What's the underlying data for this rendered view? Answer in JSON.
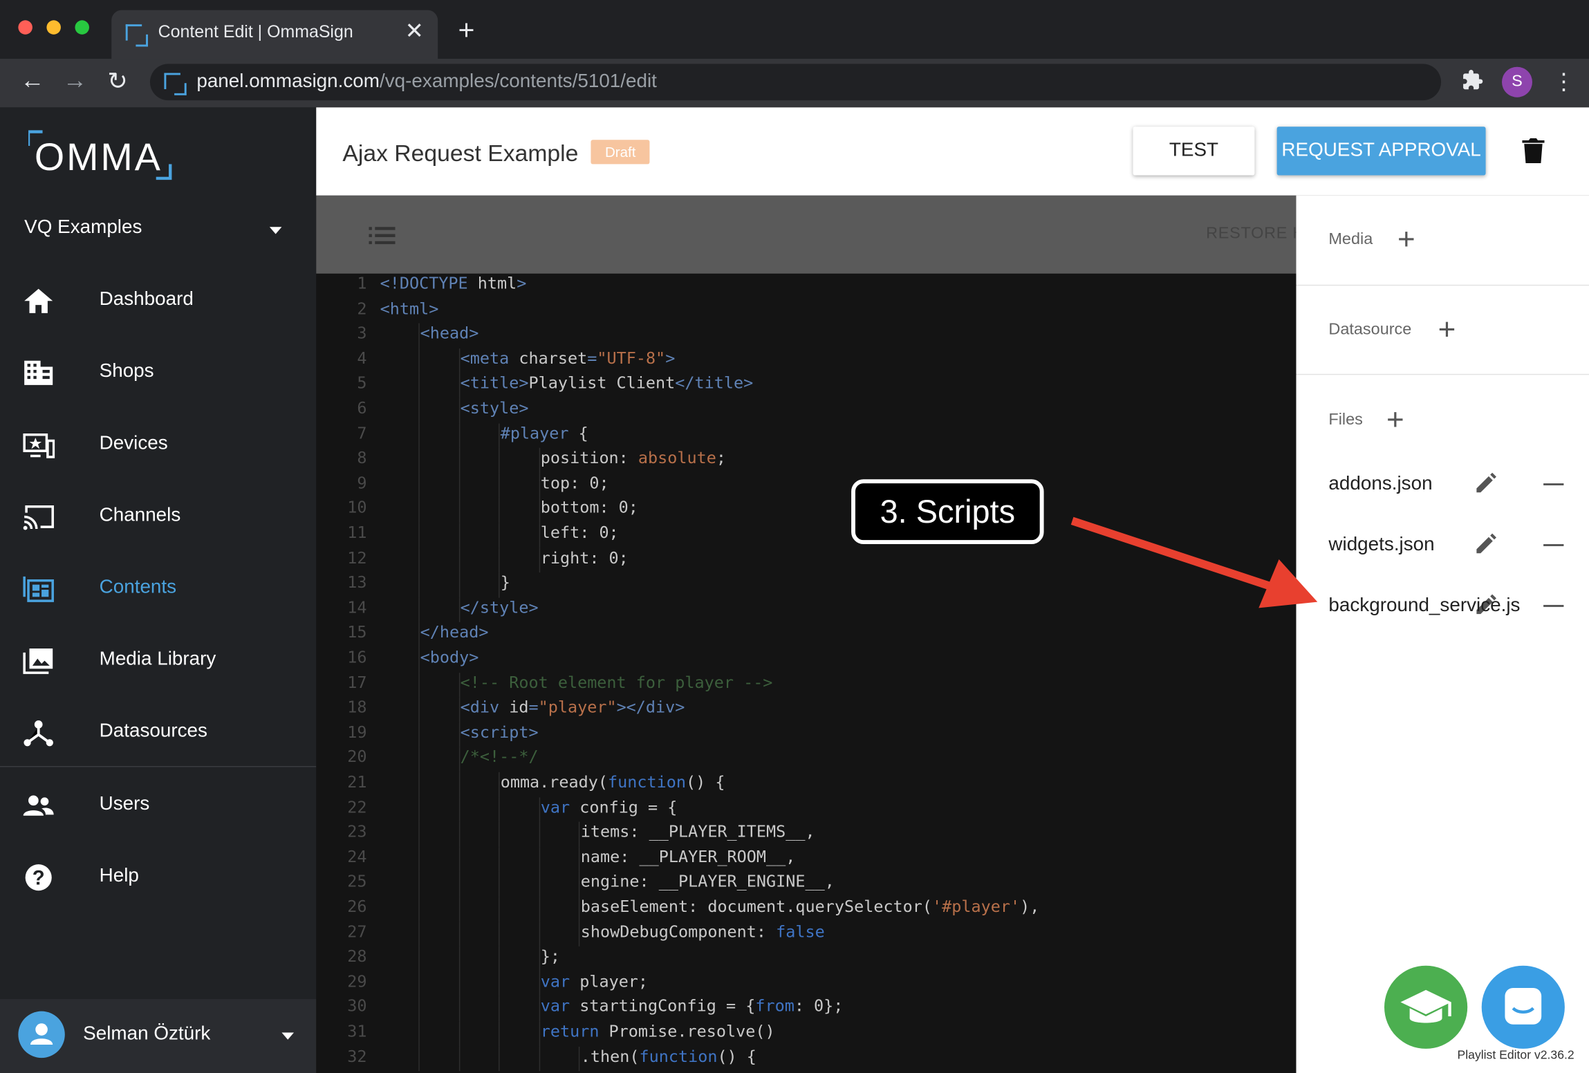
{
  "browser": {
    "tab_title": "Content Edit | OmmaSign",
    "tab_close": "✕",
    "new_tab": "+",
    "url_host": "panel.ommasign.com",
    "url_path": "/vq-examples/contents/5101/edit",
    "profile_initial": "S",
    "nav": {
      "back": "←",
      "forward": "→",
      "reload": "↻",
      "menu": "⋮"
    }
  },
  "sidebar": {
    "logo": "OMMA",
    "project": "VQ Examples",
    "items": [
      {
        "label": "Dashboard",
        "icon": "home-icon"
      },
      {
        "label": "Shops",
        "icon": "building-icon"
      },
      {
        "label": "Devices",
        "icon": "device-icon"
      },
      {
        "label": "Channels",
        "icon": "cast-icon"
      },
      {
        "label": "Contents",
        "icon": "contents-icon",
        "active": true
      },
      {
        "label": "Media Library",
        "icon": "photo-library-icon"
      },
      {
        "label": "Datasources",
        "icon": "hub-icon"
      },
      {
        "label": "Users",
        "icon": "users-icon"
      },
      {
        "label": "Help",
        "icon": "help-icon"
      }
    ],
    "user": "Selman Öztürk"
  },
  "header": {
    "title": "Ajax Request Example",
    "status": "Draft",
    "test_label": "TEST",
    "approval_label": "REQUEST APPROVAL"
  },
  "editor": {
    "restore_label": "RESTORE H",
    "lines": [
      {
        "n": "1",
        "i": 0,
        "h": "<span class='t'>&lt;!DOCTYPE</span> <span class='a'>html</span><span class='t'>&gt;</span>"
      },
      {
        "n": "2",
        "i": 0,
        "h": "<span class='t'>&lt;html&gt;</span>"
      },
      {
        "n": "3",
        "i": 1,
        "h": "<span class='t'>&lt;head&gt;</span>"
      },
      {
        "n": "4",
        "i": 2,
        "h": "<span class='t'>&lt;meta</span> <span class='a'>charset</span><span class='t'>=</span><span class='s'>\"UTF-8\"</span><span class='t'>&gt;</span>"
      },
      {
        "n": "5",
        "i": 2,
        "h": "<span class='t'>&lt;title&gt;</span>Playlist Client<span class='t'>&lt;/title&gt;</span>"
      },
      {
        "n": "6",
        "i": 2,
        "h": "<span class='t'>&lt;style&gt;</span>"
      },
      {
        "n": "7",
        "i": 3,
        "h": "<span class='t'>#player</span> {"
      },
      {
        "n": "8",
        "i": 4,
        "h": "position: <span class='s'>absolute</span>;"
      },
      {
        "n": "9",
        "i": 4,
        "h": "top: 0;"
      },
      {
        "n": "10",
        "i": 4,
        "h": "bottom: 0;"
      },
      {
        "n": "11",
        "i": 4,
        "h": "left: 0;"
      },
      {
        "n": "12",
        "i": 4,
        "h": "right: 0;"
      },
      {
        "n": "13",
        "i": 3,
        "h": "}"
      },
      {
        "n": "14",
        "i": 2,
        "h": "<span class='t'>&lt;/style&gt;</span>"
      },
      {
        "n": "15",
        "i": 1,
        "h": "<span class='t'>&lt;/head&gt;</span>"
      },
      {
        "n": "16",
        "i": 1,
        "h": "<span class='t'>&lt;body&gt;</span>"
      },
      {
        "n": "17",
        "i": 2,
        "h": "<span class='c'>&lt;!-- Root element for player --&gt;</span>"
      },
      {
        "n": "18",
        "i": 2,
        "h": "<span class='t'>&lt;div</span> <span class='a'>id</span><span class='t'>=</span><span class='s'>\"player\"</span><span class='t'>&gt;&lt;/div&gt;</span>"
      },
      {
        "n": "19",
        "i": 2,
        "h": "<span class='t'>&lt;script&gt;</span>"
      },
      {
        "n": "20",
        "i": 2,
        "h": "<span class='c'>/*&lt;!--*/</span>"
      },
      {
        "n": "21",
        "i": 3,
        "h": "omma.ready(<span class='k'>function</span>() {"
      },
      {
        "n": "22",
        "i": 4,
        "h": "<span class='k'>var</span> config = {"
      },
      {
        "n": "23",
        "i": 5,
        "h": "items: __PLAYER_ITEMS__,"
      },
      {
        "n": "24",
        "i": 5,
        "h": "name: __PLAYER_ROOM__,"
      },
      {
        "n": "25",
        "i": 5,
        "h": "engine: __PLAYER_ENGINE__,"
      },
      {
        "n": "26",
        "i": 5,
        "h": "baseElement: document.querySelector(<span class='s'>'#player'</span>),"
      },
      {
        "n": "27",
        "i": 5,
        "h": "showDebugComponent: <span class='k'>false</span>"
      },
      {
        "n": "28",
        "i": 4,
        "h": "};"
      },
      {
        "n": "29",
        "i": 4,
        "h": "<span class='k'>var</span> player;"
      },
      {
        "n": "30",
        "i": 4,
        "h": "<span class='k'>var</span> startingConfig = {<span class='k'>from</span>: 0};"
      },
      {
        "n": "31",
        "i": 4,
        "h": "<span class='k'>return</span> Promise.resolve()"
      },
      {
        "n": "32",
        "i": 5,
        "h": ".then(<span class='k'>function</span>() {"
      }
    ]
  },
  "panel": {
    "media_label": "Media",
    "datasource_label": "Datasource",
    "files_label": "Files",
    "files": [
      "addons.json",
      "widgets.json",
      "background_service.js"
    ],
    "version": "Playlist Editor v2.36.2"
  },
  "annotation": {
    "text": "3. Scripts"
  },
  "colors": {
    "accent": "#4aa3df",
    "draft": "#f7c59f",
    "sidebar": "#202225",
    "arrow": "#e8402f",
    "fab_green": "#4caf50"
  }
}
